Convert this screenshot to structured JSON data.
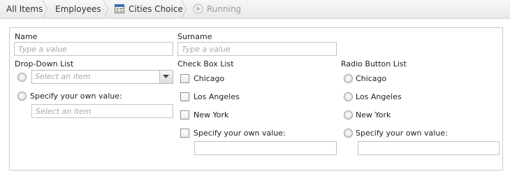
{
  "breadcrumb": {
    "items": [
      {
        "label": "All Items"
      },
      {
        "label": "Employees"
      },
      {
        "label": "Cities Choice",
        "icon": "form-icon"
      },
      {
        "label": "Running",
        "icon": "play-icon",
        "state": "current"
      }
    ]
  },
  "form": {
    "name": {
      "label": "Name",
      "placeholder": "Type a value"
    },
    "surname": {
      "label": "Surname",
      "placeholder": "Type a value"
    },
    "dropdown": {
      "label": "Drop-Down List",
      "placeholder": "Select an item",
      "own_value_label": "Specify your own value:",
      "own_value_placeholder": "Select an item"
    },
    "checkbox_list": {
      "label": "Check Box List",
      "options": [
        "Chicago",
        "Los Angeles",
        "New York",
        "Specify your own value:"
      ]
    },
    "radio_list": {
      "label": "Radio Button List",
      "options": [
        "Chicago",
        "Los Angeles",
        "New York",
        "Specify your own value:"
      ]
    }
  }
}
